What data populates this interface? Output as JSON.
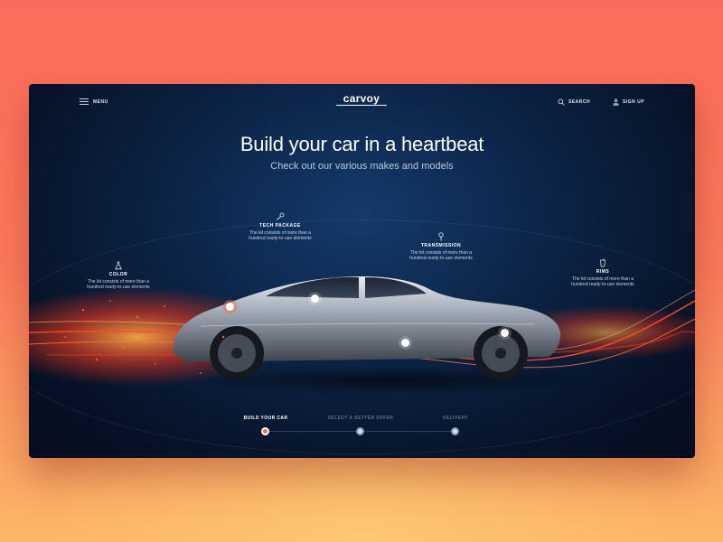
{
  "nav": {
    "menu_label": "MENU",
    "logo": "carvoy",
    "search_label": "SEARCH",
    "signup_label": "SIGN UP"
  },
  "hero": {
    "title": "Build your car in a heartbeat",
    "subtitle": "Check out our various makes and models"
  },
  "features": [
    {
      "name": "TECH PACKAGE",
      "icon": "wrench-icon",
      "desc": "The kit consists of more than a hundred ready-to-use elements"
    },
    {
      "name": "TRANSMISSION",
      "icon": "gear-knob-icon",
      "desc": "The kit consists of more than a hundred ready-to-use elements"
    },
    {
      "name": "COLOR",
      "icon": "flask-icon",
      "desc": "The kit consists of more than a hundred ready-to-use elements"
    },
    {
      "name": "RIMS",
      "icon": "cup-icon",
      "desc": "The kit consists of more than a hundred ready-to-use elements"
    }
  ],
  "steps": [
    {
      "label": "BUILD YOUR CAR",
      "active": true
    },
    {
      "label": "SELECT A BETTER OFFER",
      "active": false
    },
    {
      "label": "DELIVERY",
      "active": false
    }
  ],
  "colors": {
    "page_top": "#fb6b5b",
    "page_bottom": "#fbb868",
    "window_bg": "#0c2447",
    "accent": "#ff7043",
    "step_active_text": "#ffffff",
    "step_inactive_text": "#5d6f8c"
  }
}
